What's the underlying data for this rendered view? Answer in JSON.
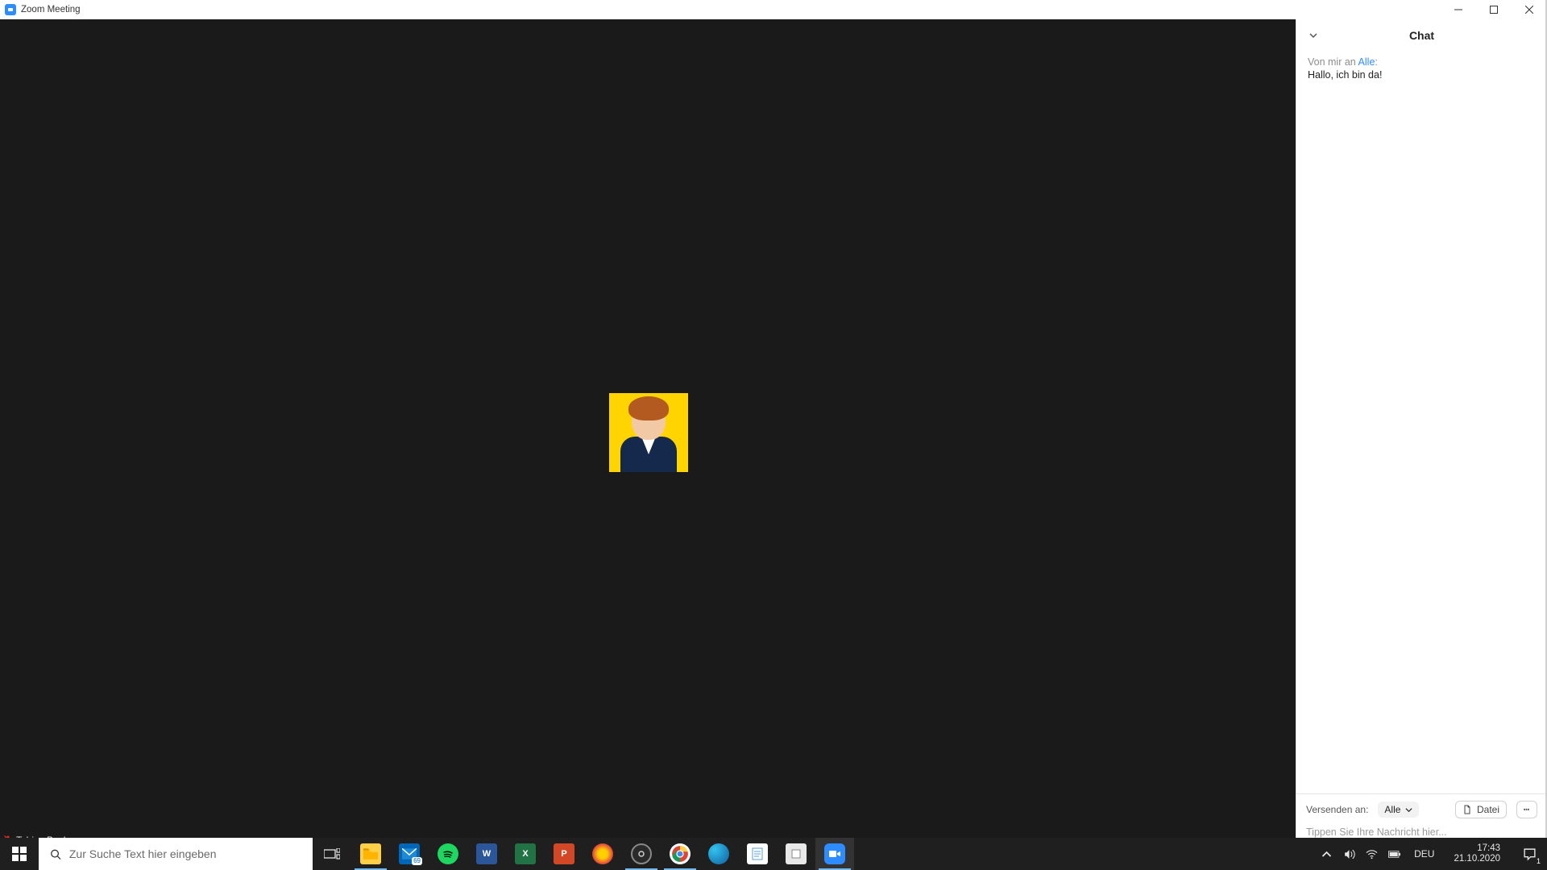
{
  "window": {
    "title": "Zoom Meeting"
  },
  "participant": {
    "name": "Tobias Becker",
    "muted": true
  },
  "chat": {
    "title": "Chat",
    "message": {
      "from_prefix": "Von mir an ",
      "to": "Alle",
      "to_suffix": ":",
      "text": "Hallo, ich bin da!"
    },
    "send_to_label": "Versenden an:",
    "send_to_value": "Alle",
    "file_label": "Datei",
    "input_placeholder": "Tippen Sie Ihre Nachricht hier..."
  },
  "taskbar": {
    "search_placeholder": "Zur Suche Text hier eingeben",
    "mail_badge": "69",
    "language": "DEU",
    "time": "17:43",
    "date": "21.10.2020",
    "notification_count": "1"
  },
  "colors": {
    "zoom_blue": "#2d8cff",
    "video_bg": "#1a1a1a",
    "avatar_bg": "#ffd400"
  }
}
